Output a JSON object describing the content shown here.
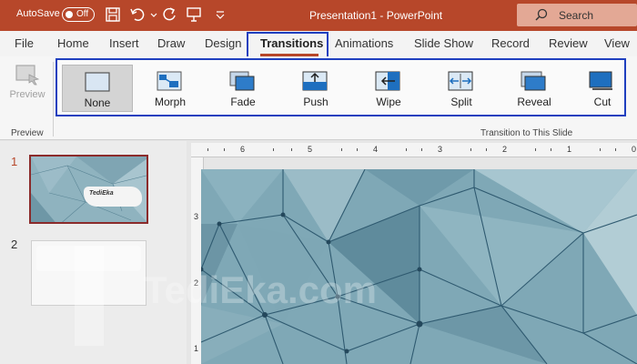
{
  "titlebar": {
    "autosave_label": "AutoSave",
    "autosave_state": "Off",
    "doc_title": "Presentation1  -  PowerPoint",
    "search_placeholder": "Search",
    "color": "#b7472a"
  },
  "tabs": [
    {
      "label": "File"
    },
    {
      "label": "Home"
    },
    {
      "label": "Insert"
    },
    {
      "label": "Draw"
    },
    {
      "label": "Design"
    },
    {
      "label": "Transitions",
      "active": true
    },
    {
      "label": "Animations"
    },
    {
      "label": "Slide Show"
    },
    {
      "label": "Record"
    },
    {
      "label": "Review"
    },
    {
      "label": "View"
    }
  ],
  "ribbon": {
    "preview_label": "Preview",
    "preview_group_label": "Preview",
    "transitions_group_label": "Transition to This Slide",
    "transitions": [
      {
        "label": "None",
        "icon": "none-transition-icon",
        "selected": true
      },
      {
        "label": "Morph",
        "icon": "morph-transition-icon"
      },
      {
        "label": "Fade",
        "icon": "fade-transition-icon"
      },
      {
        "label": "Push",
        "icon": "push-transition-icon"
      },
      {
        "label": "Wipe",
        "icon": "wipe-transition-icon"
      },
      {
        "label": "Split",
        "icon": "split-transition-icon"
      },
      {
        "label": "Reveal",
        "icon": "reveal-transition-icon"
      },
      {
        "label": "Cut",
        "icon": "cut-transition-icon"
      }
    ]
  },
  "slides": [
    {
      "number": "1",
      "selected": true,
      "thumb_text": "TediEka"
    },
    {
      "number": "2",
      "selected": false
    }
  ],
  "rulers": {
    "top": [
      "6",
      "5",
      "4",
      "3",
      "2",
      "1",
      "0"
    ],
    "left": [
      "3",
      "2",
      "1"
    ]
  },
  "watermark": {
    "text": "TediEka.com"
  },
  "colors": {
    "highlight_box": "#1f3fbf",
    "accent": "#b7472a"
  }
}
